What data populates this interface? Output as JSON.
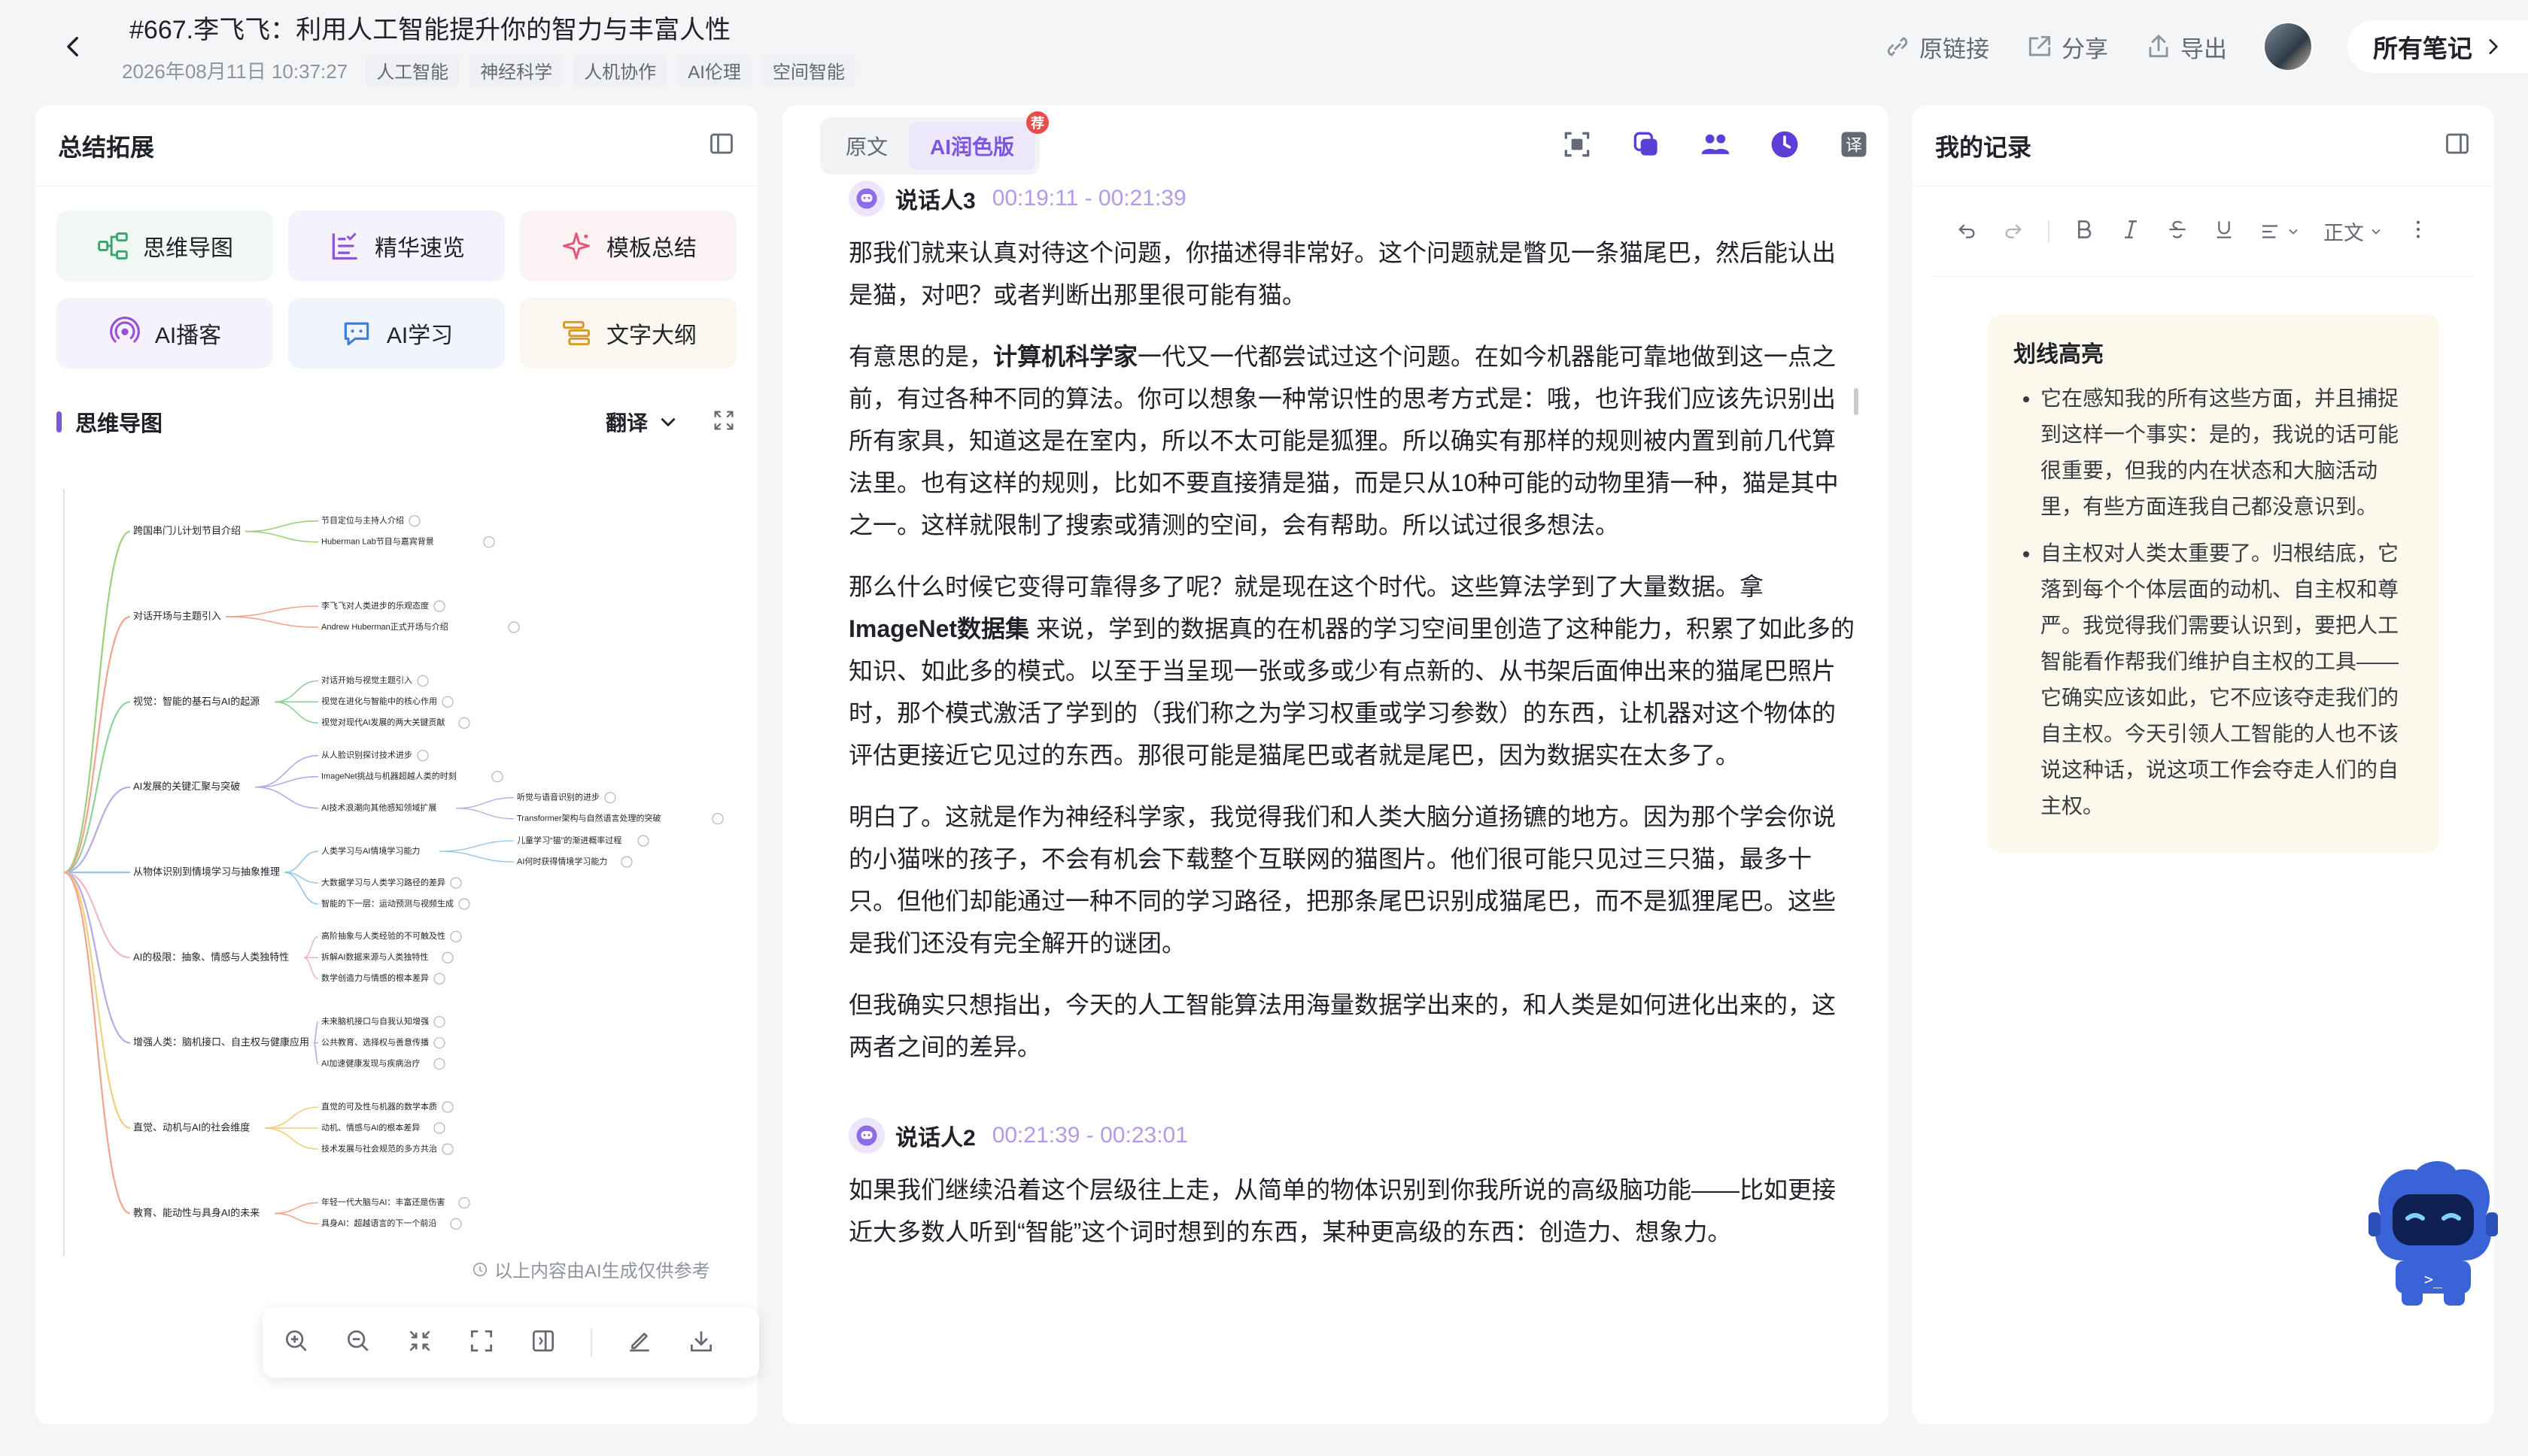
{
  "header": {
    "title": "#667.李飞飞：利用人工智能提升你的智力与丰富人性",
    "date": "2026年08月11日 10:37:27",
    "tags": [
      "人工智能",
      "神经科学",
      "人机协作",
      "AI伦理",
      "空间智能"
    ],
    "actions": {
      "link": "原链接",
      "share": "分享",
      "export": "导出"
    },
    "all_notes": "所有笔记"
  },
  "left": {
    "title": "总结拓展",
    "features": [
      {
        "label": "思维导图",
        "icon": "mindmap-icon"
      },
      {
        "label": "精华速览",
        "icon": "list-icon"
      },
      {
        "label": "模板总结",
        "icon": "sparkle-icon"
      },
      {
        "label": "AI播客",
        "icon": "podcast-icon"
      },
      {
        "label": "AI学习",
        "icon": "chat-icon"
      },
      {
        "label": "文字大纲",
        "icon": "outline-icon"
      }
    ],
    "mindmap_title": "思维导图",
    "translate": "翻译",
    "mindmap_note": "以上内容由AI生成仅供参考",
    "mindmap": [
      {
        "label": "跨国串门儿计划节目介绍",
        "color": "#9ad07a",
        "children": [
          {
            "label": "节目定位与主持人介绍"
          },
          {
            "label": "Huberman Lab节目与嘉宾背景"
          }
        ]
      },
      {
        "label": "对话开场与主题引入",
        "color": "#f2a38a",
        "children": [
          {
            "label": "李飞飞对人类进步的乐观态度"
          },
          {
            "label": "Andrew Huberman正式开场与介绍"
          }
        ]
      },
      {
        "label": "视觉：智能的基石与AI的起源",
        "color": "#8ed29a",
        "children": [
          {
            "label": "对话开始与视觉主题引入"
          },
          {
            "label": "视觉在进化与智能中的核心作用"
          },
          {
            "label": "视觉对现代AI发展的两大关键贡献"
          }
        ]
      },
      {
        "label": "AI发展的关键汇聚与突破",
        "color": "#b9a7ea",
        "children": [
          {
            "label": "从人脸识别探讨技术进步"
          },
          {
            "label": "ImageNet挑战与机器超越人类的时刻"
          },
          {
            "label": "AI技术浪潮向其他感知领域扩展",
            "children": [
              {
                "label": "听觉与语音识别的进步"
              },
              {
                "label": "Transformer架构与自然语言处理的突破"
              }
            ]
          }
        ]
      },
      {
        "label": "从物体识别到情境学习与抽象推理",
        "color": "#93c5e8",
        "children": [
          {
            "label": "人类学习与AI情境学习能力",
            "children": [
              {
                "label": "儿童学习“猫”的渐进概率过程"
              },
              {
                "label": "AI何时获得情境学习能力"
              }
            ]
          },
          {
            "label": "大数据学习与人类学习路径的差异"
          },
          {
            "label": "智能的下一层：运动预测与视频生成"
          }
        ]
      },
      {
        "label": "AI的极限：抽象、情感与人类独特性",
        "color": "#f0b6c7",
        "children": [
          {
            "label": "高阶抽象与人类经验的不可触及性"
          },
          {
            "label": "拆解AI数据来源与人类独特性"
          },
          {
            "label": "数学创造力与情感的根本差异"
          }
        ]
      },
      {
        "label": "增强人类：脑机接口、自主权与健康应用",
        "color": "#b9a7ea",
        "children": [
          {
            "label": "未来脑机接口与自我认知增强"
          },
          {
            "label": "公共教育、选择权与善意传播"
          },
          {
            "label": "AI加速健康发现与疾病治疗"
          }
        ]
      },
      {
        "label": "直觉、动机与AI的社会维度",
        "color": "#f2cf7a",
        "children": [
          {
            "label": "直觉的可及性与机器的数学本质"
          },
          {
            "label": "动机、情感与AI的根本差异"
          },
          {
            "label": "技术发展与社会规范的多方共治"
          }
        ]
      },
      {
        "label": "教育、能动性与具身AI的未来",
        "color": "#f2a38a",
        "children": [
          {
            "label": "年轻一代大脑与AI：丰富还是伤害"
          },
          {
            "label": "具身AI：超越语言的下一个前沿"
          }
        ]
      }
    ]
  },
  "middle": {
    "tabs": [
      {
        "label": "原文"
      },
      {
        "label": "AI润色版"
      }
    ],
    "tab_badge": "荐",
    "speaker1": {
      "name": "说话人3",
      "time": "00:19:11 - 00:21:39"
    },
    "paras1": [
      "那我们就来认真对待这个问题，你描述得非常好。这个问题就是瞥见一条猫尾巴，然后能认出是猫，对吧？或者判断出那里很可能有猫。",
      "有意思的是，",
      "计算机科学家",
      "一代又一代都尝试过这个问题。在如今机器能可靠地做到这一点之前，有过各种不同的算法。你可以想象一种常识性的思考方式是：哦，也许我们应该先识别出所有家具，知道这是在室内，所以不太可能是狐狸。所以确实有那样的规则被内置到前几代算法里。也有这样的规则，比如不要直接猜是猫，而是只从10种可能的动物里猜一种，猫是其中之一。这样就限制了搜索或猜测的空间，会有帮助。所以试过很多想法。",
      "那么什么时候它变得可靠得多了呢？就是现在这个时代。这些算法学到了大量数据。拿 ",
      "ImageNet数据集",
      " 来说，学到的数据真的在机器的学习空间里创造了这种能力，积累了如此多的知识、如此多的模式。以至于当呈现一张或多或少有点新的、从书架后面伸出来的猫尾巴照片时，那个模式激活了学到的（我们称之为学习权重或学习参数）的东西，让机器对这个物体的评估更接近它见过的东西。那很可能是猫尾巴或者就是尾巴，因为数据实在太多了。",
      "明白了。这就是作为神经科学家，我觉得我们和人类大脑分道扬镳的地方。因为那个学会你说的小猫咪的孩子，不会有机会下载整个互联网的猫图片。他们很可能只见过三只猫，最多十只。但他们却能通过一种不同的学习路径，把那条尾巴识别成猫尾巴，而不是狐狸尾巴。这些是我们还没有完全解开的谜团。",
      "但我确实只想指出，今天的人工智能算法用海量数据学出来的，和人类是如何进化出来的，这两者之间的差异。"
    ],
    "speaker2": {
      "name": "说话人2",
      "time": "00:21:39 - 00:23:01"
    },
    "paras2": [
      "如果我们继续沿着这个层级往上走，从简单的物体识别到你我所说的高级脑功能——比如更接近大多数人听到“智能”这个词时想到的东西，某种更高级的东西：创造力、想象力。"
    ]
  },
  "right": {
    "title": "我的记录",
    "text_style": "正文",
    "highlight_title": "划线高亮",
    "highlights": [
      "它在感知我的所有这些方面，并且捕捉到这样一个事实：是的，我说的话可能很重要，但我的内在状态和大脑活动里，有些方面连我自己都没意识到。",
      "自主权对人类太重要了。归根结底，它落到每个个体层面的动机、自主权和尊严。我觉得我们需要认识到，要把人工智能看作帮我们维护自主权的工具——它确实应该如此，它不应该夺走我们的自主权。今天引领人工智能的人也不该说这种话，说这项工作会夺走人们的自主权。"
    ]
  },
  "colors": {
    "accent": "#7b56e0",
    "badge": "#e84c4c",
    "highlight_bg": "#fdf8ec"
  }
}
